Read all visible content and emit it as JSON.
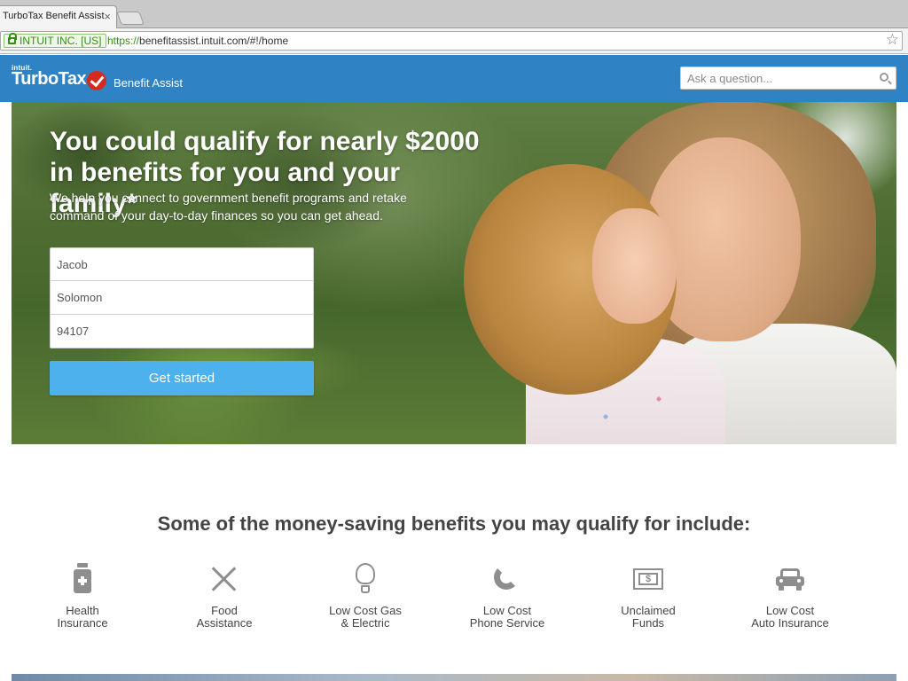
{
  "browser": {
    "tab_title": "TurboTax Benefit Assist",
    "tab_close": "×",
    "ev_badge": "INTUIT INC. [US]",
    "url_scheme": "https://",
    "url_rest": "benefitassist.intuit.com/#!/home",
    "bookmark_star": "☆"
  },
  "header": {
    "brand_small": "intuit.",
    "brand": "TurboTax",
    "product": "Benefit Assist",
    "search_placeholder": "Ask a question..."
  },
  "hero": {
    "headline_line1": "You could qualify for nearly $2000",
    "headline_line2": "in benefits for you and your family*",
    "subtext_line1": "We help you connect to government benefit programs and retake",
    "subtext_line2": "command of your day-to-day finances so you can get ahead.",
    "first_name_value": "Jacob",
    "last_name_value": "Solomon",
    "zip_value": "94107",
    "cta_label": "Get started"
  },
  "benefits": {
    "title": "Some of the money-saving benefits you may qualify for include:",
    "items": [
      {
        "icon": "medicine-bottle-icon",
        "line1": "Health",
        "line2": "Insurance"
      },
      {
        "icon": "fork-knife-icon",
        "line1": "Food",
        "line2": "Assistance"
      },
      {
        "icon": "lightbulb-icon",
        "line1": "Low Cost Gas",
        "line2": "& Electric"
      },
      {
        "icon": "phone-icon",
        "line1": "Low Cost",
        "line2": "Phone Service"
      },
      {
        "icon": "dollar-bill-icon",
        "line1": "Unclaimed",
        "line2": "Funds"
      },
      {
        "icon": "car-icon",
        "line1": "Low Cost",
        "line2": "Auto Insurance"
      }
    ]
  },
  "colors": {
    "header_blue": "#2f83c5",
    "cta_blue": "#4cb1ec",
    "brand_red": "#d52b1e",
    "icon_gray": "#8e8e8e"
  }
}
